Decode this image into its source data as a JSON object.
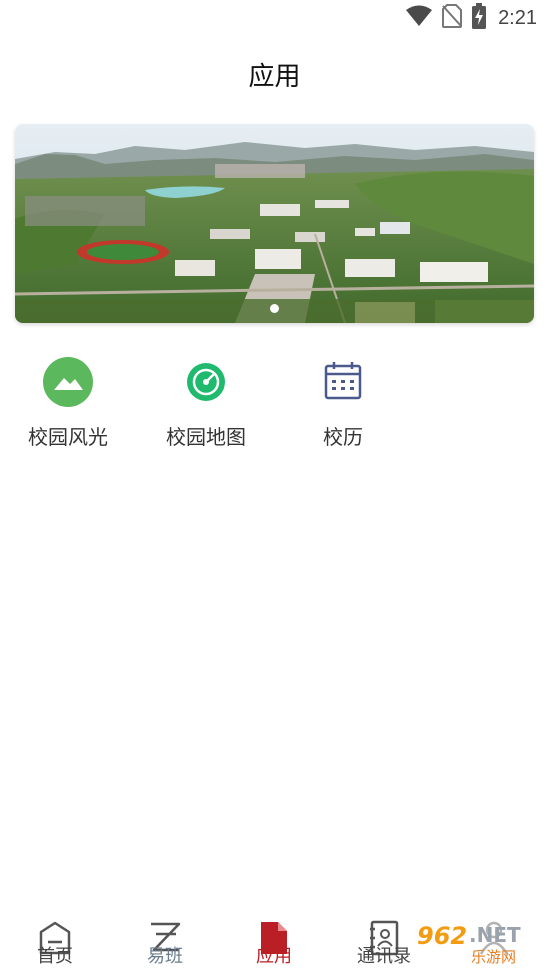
{
  "status_bar": {
    "time": "2:21",
    "icons": [
      "wifi-icon",
      "no-sim-icon",
      "battery-charging-icon"
    ]
  },
  "header": {
    "title": "应用"
  },
  "banner": {
    "image": "campus-aerial-photo",
    "slide_count": 1,
    "active_slide": 1
  },
  "apps": [
    {
      "label": "校园风光",
      "icon": "landscape-icon",
      "color": "#5cb85c"
    },
    {
      "label": "校园地图",
      "icon": "radar-map-icon",
      "color": "#1fba6e"
    },
    {
      "label": "校历",
      "icon": "calendar-icon",
      "color": "#4a5a8c"
    }
  ],
  "bottom_nav": {
    "items": [
      {
        "label": "首页",
        "icon": "home-icon"
      },
      {
        "label": "易班",
        "icon": "yiban-icon"
      },
      {
        "label": "应用",
        "icon": "document-icon",
        "active": true
      },
      {
        "label": "通讯录",
        "icon": "contacts-book-icon"
      },
      {
        "label": "",
        "icon": "user-profile-icon"
      }
    ],
    "active_color": "#b91f24"
  },
  "watermark": {
    "text": "962.NET",
    "subtext": "乐游网"
  }
}
